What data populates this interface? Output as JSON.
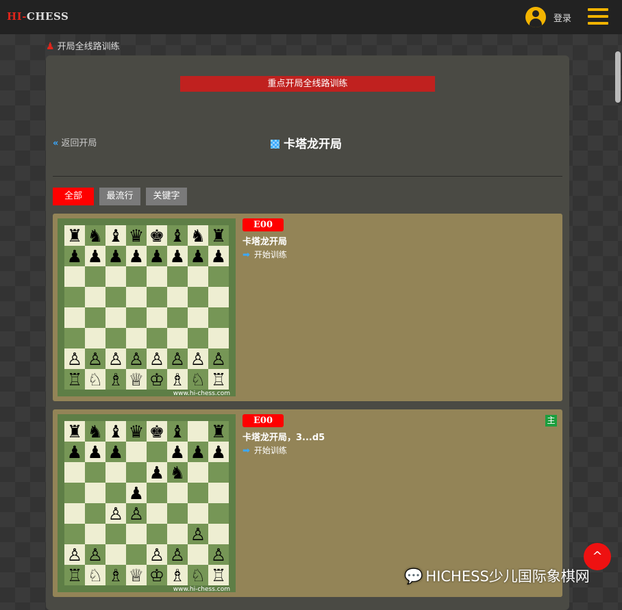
{
  "header": {
    "logo_hi": "HI-",
    "logo_chess": "CHESS",
    "login": "登录"
  },
  "breadcrumb": {
    "label": "开局全线路训练"
  },
  "banner": {
    "label": "重点开局全线路训练"
  },
  "back_link": {
    "chevron": "«",
    "label": "返回开局"
  },
  "page_title": "卡塔龙开局",
  "filters": [
    {
      "label": "全部",
      "active": true
    },
    {
      "label": "最流行",
      "active": false
    },
    {
      "label": "关键字",
      "active": false
    }
  ],
  "cards": [
    {
      "eco": "E00",
      "name": "卡塔龙开局",
      "start_label": "开始训练",
      "main_badge": "",
      "board_caption": "www.hi-chess.com",
      "board": [
        "rnbqkbnr",
        "pppppppp",
        "........",
        "........",
        "........",
        "........",
        "PPPPPPPP",
        "RNBQKBNR"
      ]
    },
    {
      "eco": "E00",
      "name": "卡塔龙开局，3...d5",
      "start_label": "开始训练",
      "main_badge": "主",
      "board_caption": "www.hi-chess.com",
      "board": [
        "rnbqkb.r",
        "ppp..ppp",
        "....pn..",
        "...p....",
        "..PP....",
        "......P.",
        "PP..PP.P",
        "RNBQKBNR"
      ]
    }
  ],
  "watermark": "HICHESS少儿国际象棋网",
  "scroll_top": "^",
  "colors": {
    "accent_red": "#ff0000",
    "brand_yellow": "#f2b300",
    "card_bg": "#938457",
    "board_light": "#eeeed2",
    "board_dark": "#769656"
  }
}
